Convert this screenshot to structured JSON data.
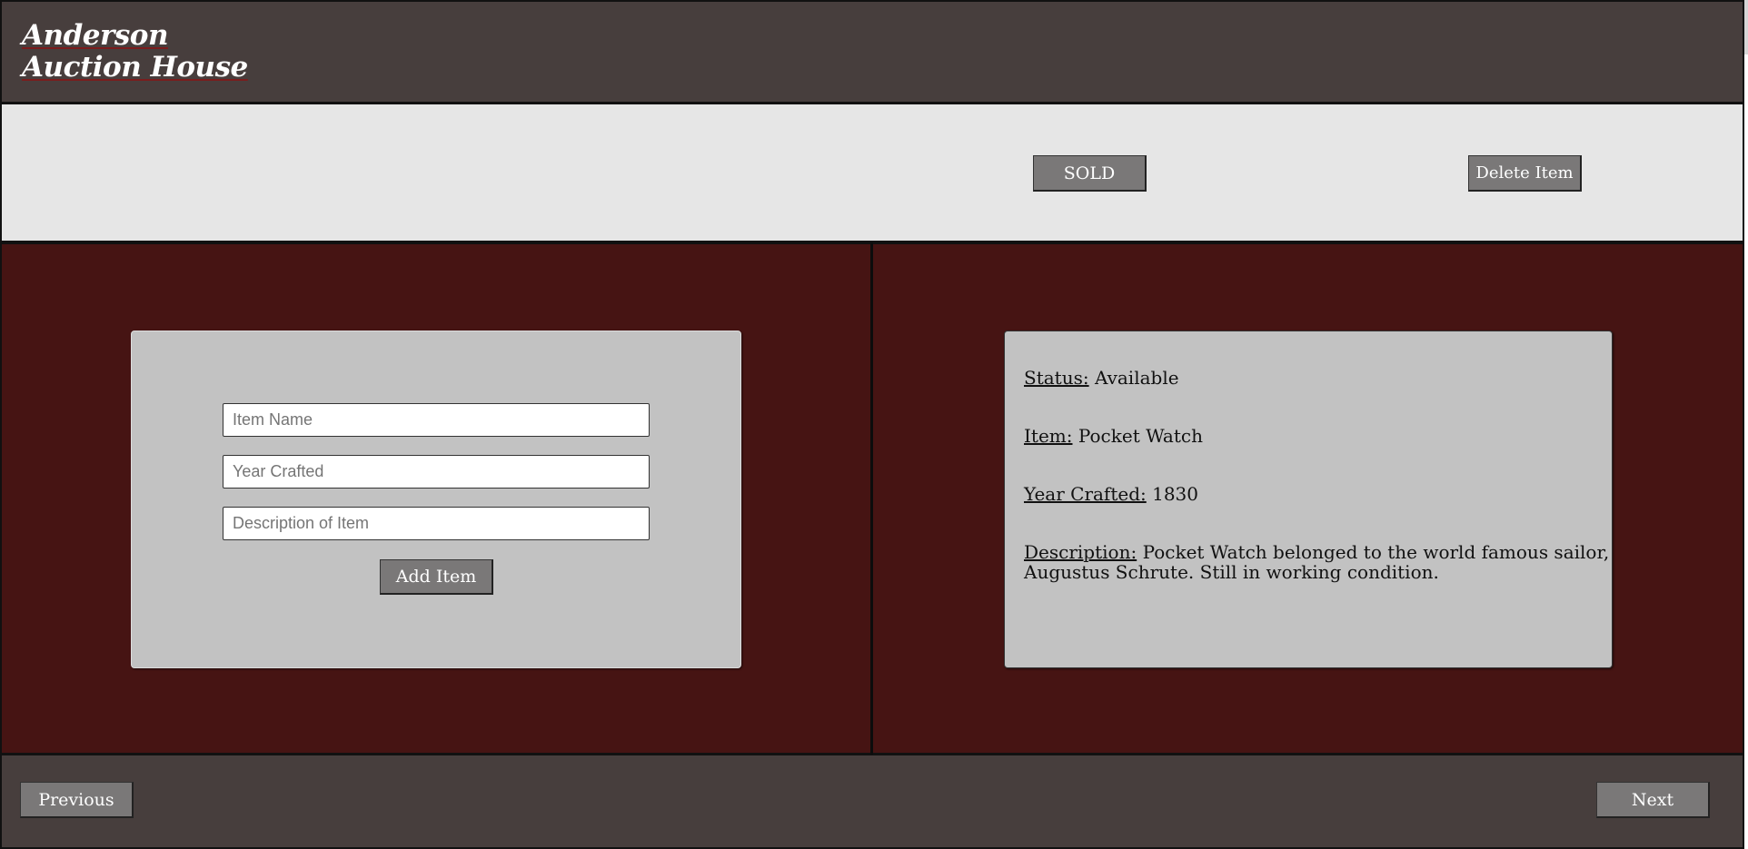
{
  "header": {
    "brand_line1": "Anderson",
    "brand_line2": "Auction House"
  },
  "actions": {
    "sold_label": "SOLD",
    "delete_label": "Delete Item"
  },
  "form": {
    "item_name_placeholder": "Item Name",
    "year_crafted_placeholder": "Year Crafted",
    "description_placeholder": "Description of Item",
    "add_label": "Add Item"
  },
  "detail": {
    "status_label": "Status:",
    "status_value": "Available",
    "item_label": "Item:",
    "item_value": "Pocket Watch",
    "year_label": "Year Crafted:",
    "year_value": "1830",
    "description_label": "Description:",
    "description_value": "Pocket Watch belonged to the world famous sailor, Augustus Schrute. Still in working condition."
  },
  "nav": {
    "previous_label": "Previous",
    "next_label": "Next"
  },
  "colors": {
    "header_bg": "#473e3d",
    "action_bar_bg": "#e6e6e6",
    "main_bg": "#461413",
    "card_bg": "#c2c2c2",
    "button_bg": "#7a7878"
  }
}
